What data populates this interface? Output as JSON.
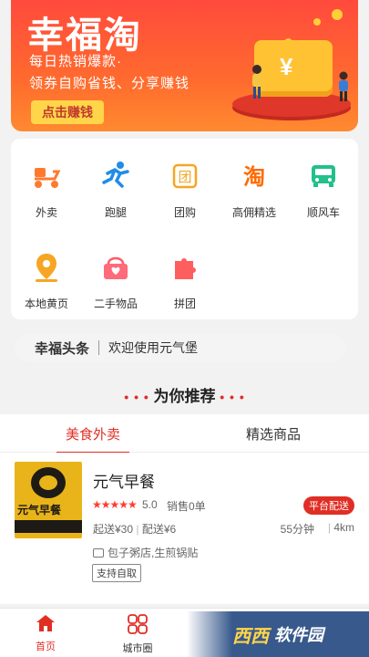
{
  "banner": {
    "title": "幸福淘",
    "line1": "每日热销爆款·",
    "line2": "领券自购省钱、分享赚钱",
    "cta": "点击赚钱",
    "wallet_symbol": "¥"
  },
  "grid": [
    {
      "label": "外卖",
      "icon": "delivery-scooter-icon"
    },
    {
      "label": "跑腿",
      "icon": "runner-icon"
    },
    {
      "label": "团购",
      "icon": "group-buy-icon"
    },
    {
      "label": "高佣精选",
      "icon": "taobao-icon"
    },
    {
      "label": "顺风车",
      "icon": "car-icon"
    },
    {
      "label": "本地黄页",
      "icon": "location-pin-icon"
    },
    {
      "label": "二手物品",
      "icon": "gift-basket-icon"
    },
    {
      "label": "拼团",
      "icon": "puzzle-icon"
    }
  ],
  "headline": {
    "brand": "幸福头条",
    "message": "欢迎使用元气堡"
  },
  "recommend": {
    "dots_left": "• • •",
    "title": "为你推荐",
    "dots_right": "• • •"
  },
  "tabs": [
    {
      "label": "美食外卖",
      "active": true
    },
    {
      "label": "精选商品",
      "active": false
    }
  ],
  "shop": {
    "logo_text": "元气早餐",
    "name": "元气早餐",
    "badge": "平台配送",
    "stars": "★★★★★",
    "score": "5.0",
    "sales": "销售0单",
    "min_order": "起送¥30",
    "delivery_fee": "配送¥6",
    "divider": "|",
    "time": "55分钟",
    "distance": "4km",
    "tags": "包子粥店,生煎锅贴",
    "pickup": "支持自取"
  },
  "nav": [
    {
      "label": "首页",
      "icon": "home-icon",
      "active": true
    },
    {
      "label": "城市圈",
      "icon": "city-circle-icon",
      "active": false
    }
  ],
  "watermark": {
    "brand": "西西",
    "text": "软件园"
  },
  "colors": {
    "accent": "#e02e24",
    "banner": "#ff5a36",
    "gold": "#ffd54a"
  }
}
